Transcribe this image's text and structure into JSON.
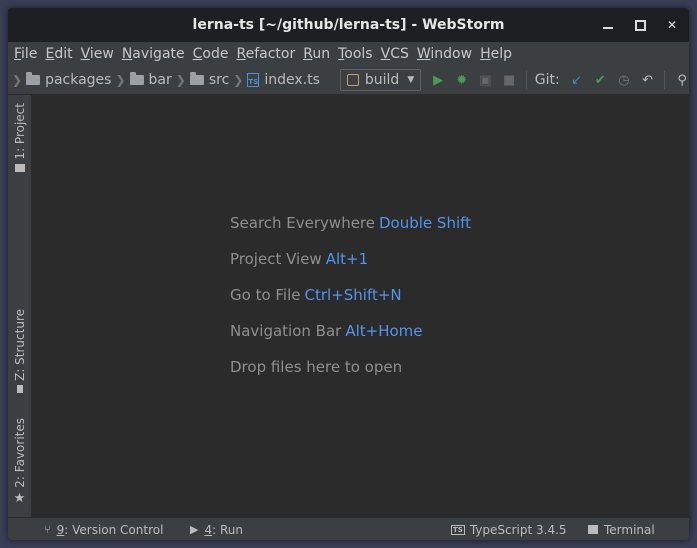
{
  "window": {
    "title": "lerna-ts [~/github/lerna-ts] - WebStorm"
  },
  "menu": {
    "items": [
      {
        "mnemonic": "F",
        "rest": "ile"
      },
      {
        "mnemonic": "E",
        "rest": "dit"
      },
      {
        "mnemonic": "V",
        "rest": "iew"
      },
      {
        "mnemonic": "N",
        "rest": "avigate"
      },
      {
        "mnemonic": "C",
        "rest": "ode"
      },
      {
        "mnemonic": "R",
        "rest": "efactor"
      },
      {
        "mnemonic": "R",
        "rest": "un"
      },
      {
        "mnemonic": "T",
        "rest": "ools"
      },
      {
        "mnemonic": "V",
        "rest": "CS"
      },
      {
        "mnemonic": "W",
        "rest": "indow"
      },
      {
        "mnemonic": "H",
        "rest": "elp"
      }
    ]
  },
  "navbar": {
    "crumbs": [
      "packages",
      "bar",
      "src",
      "index.ts"
    ],
    "run_config": "build",
    "git_label": "Git:"
  },
  "sidebar": {
    "project": "1: Project",
    "structure": "Z: Structure",
    "favorites": "2: Favorites"
  },
  "editor": {
    "hints": [
      {
        "text": "Search Everywhere",
        "key": "Double Shift"
      },
      {
        "text": "Project View",
        "key": "Alt+1"
      },
      {
        "text": "Go to File",
        "key": "Ctrl+Shift+N"
      },
      {
        "text": "Navigation Bar",
        "key": "Alt+Home"
      },
      {
        "text": "Drop files here to open",
        "key": ""
      }
    ]
  },
  "statusbar": {
    "vcs_num": "9",
    "vcs_label": ": Version Control",
    "run_num": "4",
    "run_label": ": Run",
    "typescript": "TypeScript 3.4.5",
    "terminal": "Terminal"
  },
  "colors": {
    "accent_link": "#5394ec",
    "run_green": "#499c54",
    "git_blue": "#3592c4"
  }
}
